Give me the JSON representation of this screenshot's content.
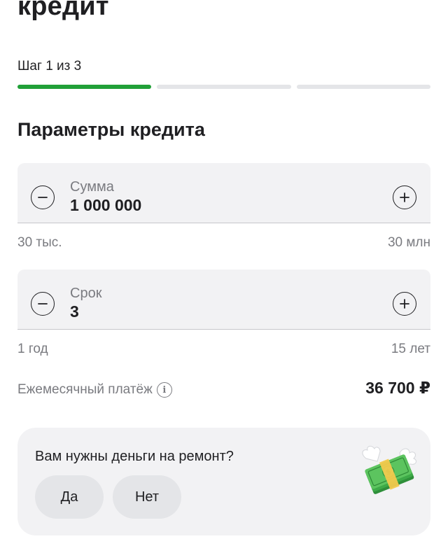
{
  "header": {
    "title": "кредит"
  },
  "stepper": {
    "label": "Шаг 1 из 3",
    "current": 1,
    "total": 3
  },
  "section": {
    "title": "Параметры кредита"
  },
  "amount": {
    "label": "Сумма",
    "value": "1 000 000",
    "min": "30 тыс.",
    "max": "30 млн"
  },
  "term": {
    "label": "Срок",
    "value": "3",
    "min": "1 год",
    "max": "15 лет"
  },
  "payment": {
    "label": "Ежемесячный платёж",
    "value": "36 700 ₽"
  },
  "question": {
    "text": "Вам нужны деньги на ремонт?",
    "yes_label": "Да",
    "no_label": "Нет"
  },
  "colors": {
    "accent": "#21a038",
    "field_bg": "#f2f2f4",
    "muted_text": "#7a7b80"
  }
}
